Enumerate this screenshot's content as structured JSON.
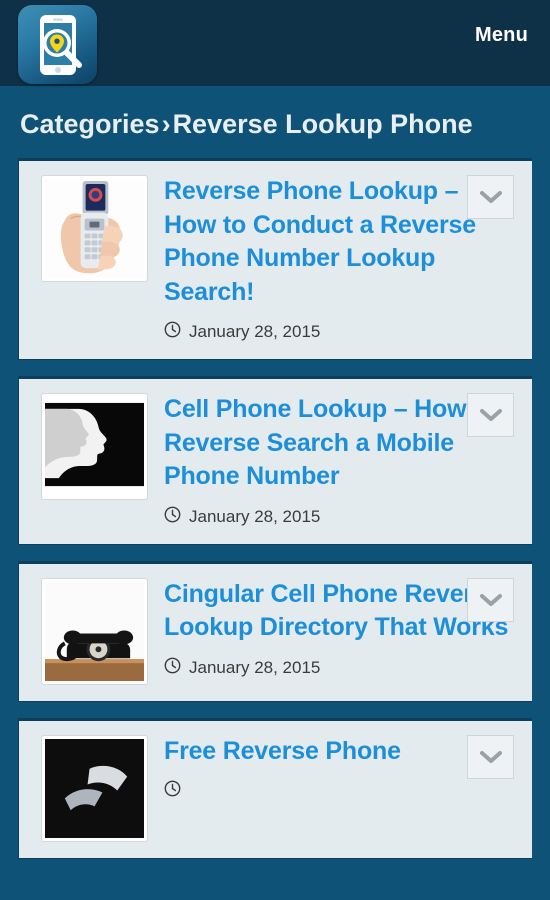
{
  "header": {
    "logo_icon": "phone-search-logo-icon",
    "menu_label": "Menu"
  },
  "breadcrumb": {
    "root_label": "Categories",
    "separator": "›",
    "current_label": "Reverse Lookup Phone"
  },
  "colors": {
    "page_background": "#0f5278",
    "header_background": "#0f3148",
    "card_background": "#e4ebef",
    "card_border": "#0d3e5c",
    "link_blue": "#1c8fd8",
    "breadcrumb_text": "#e9eef2",
    "meta_text": "#3b3b3b",
    "logo_accent_yellow": "#f7d417"
  },
  "articles": [
    {
      "title": "Reverse Phone Lookup – How to Conduct a Reverse Phone Number Lookup Search!",
      "date": "January 28, 2015",
      "date_icon": "clock-icon",
      "expand_icon": "chevron-down-icon",
      "thumbnail": "hand-holding-silver-flip-phone"
    },
    {
      "title": "Cell Phone Lookup – How to Reverse Search a Mobile Phone Number",
      "date": "January 28, 2015",
      "date_icon": "clock-icon",
      "expand_icon": "chevron-down-icon",
      "thumbnail": "black-and-white-face-silhouette"
    },
    {
      "title": "Cingular Cell Phone Reverse Lookup Directory That Works",
      "date": "January 28, 2015",
      "date_icon": "clock-icon",
      "expand_icon": "chevron-down-icon",
      "thumbnail": "vintage-black-rotary-telephone"
    },
    {
      "title": "Free Reverse Phone",
      "date": "",
      "date_icon": "clock-icon",
      "expand_icon": "chevron-down-icon",
      "thumbnail": "dark-phone-photo"
    }
  ]
}
